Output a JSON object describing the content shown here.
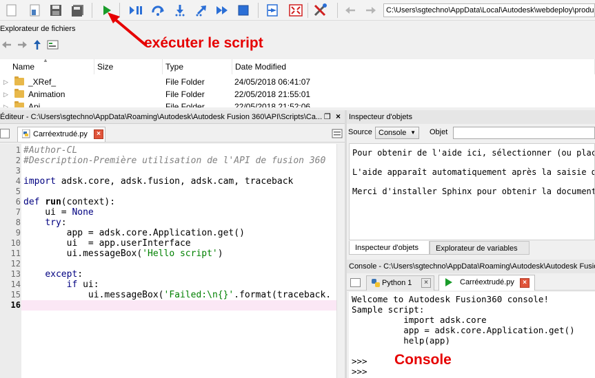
{
  "toolbar": {
    "path": "C:\\Users\\sgtechno\\AppData\\Local\\Autodesk\\webdeploy\\produc",
    "icons": [
      "new-file-icon",
      "open-file-icon",
      "save-icon",
      "save-all-icon",
      "run-icon",
      "pause-icon",
      "step-over-icon",
      "step-into-icon",
      "step-out-icon",
      "continue-icon",
      "stop-icon",
      "export-icon",
      "fullscreen-icon",
      "tools-icon",
      "back-arrow-icon",
      "forward-arrow-icon"
    ],
    "accent_run": "#1a9c2a",
    "accent_debug": "#2b6fd6"
  },
  "annotations": {
    "run_script": "exécuter le script",
    "console": "Console",
    "color": "#e60000"
  },
  "explorer": {
    "title": "Explorateur de fichiers",
    "columns": [
      "Name",
      "Size",
      "Type",
      "Date Modified"
    ],
    "rows": [
      {
        "name": "_XRef_",
        "size": "",
        "type": "File Folder",
        "date": "24/05/2018 06:41:07"
      },
      {
        "name": "Animation",
        "size": "",
        "type": "File Folder",
        "date": "22/05/2018 21:55:01"
      },
      {
        "name": "Api",
        "size": "",
        "type": "File Folder",
        "date": "22/05/2018 21:52:06"
      }
    ]
  },
  "editor": {
    "title": "Éditeur - C:\\Users\\sgtechno\\AppData\\Roaming\\Autodesk\\Autodesk Fusion 360\\API\\Scripts\\Ca...",
    "tab": "Carréextrudé.py",
    "line_numbers": [
      "1",
      "2",
      "3",
      "4",
      "5",
      "6",
      "7",
      "8",
      "9",
      "10",
      "11",
      "12",
      "13",
      "14",
      "15",
      "16"
    ],
    "current_line": "16"
  },
  "inspector": {
    "title": "Inspecteur d'objets",
    "source_label": "Source",
    "source_value": "Console",
    "object_label": "Objet",
    "lines": [
      "Pour obtenir de l'aide ici, sélectionner (ou placer",
      "L'aide apparaît automatiquement après la saisie d'u",
      "Merci d'installer Sphinx pour obtenir la documentat"
    ],
    "tabs": [
      "Inspecteur d'objets",
      "Explorateur de variables"
    ]
  },
  "console": {
    "title": "Console - C:\\Users\\sgtechno\\AppData\\Roaming\\Autodesk\\Autodesk Fusion",
    "tabs": [
      "Python 1",
      "Carréextrudé.py"
    ],
    "lines": [
      "Welcome to Autodesk Fusion360 console!",
      "Sample script:",
      "          import adsk.core",
      "          app = adsk.core.Application.get()",
      "          help(app)",
      "",
      ">>>",
      ">>>"
    ]
  }
}
